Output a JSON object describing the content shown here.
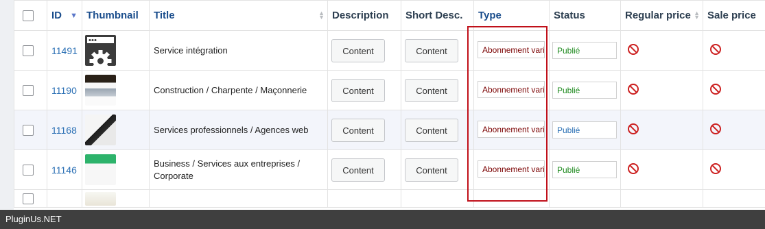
{
  "columns": {
    "id": "ID",
    "thumbnail": "Thumbnail",
    "title": "Title",
    "description": "Description",
    "short_desc": "Short Desc.",
    "type": "Type",
    "status": "Status",
    "regular_price": "Regular price",
    "sale_price": "Sale price"
  },
  "rows": [
    {
      "id": "11491",
      "title": "Service intégration",
      "description": "Content",
      "short_desc": "Content",
      "type": "Abonnement variable",
      "status": "Publié",
      "status_color": "#1e8a1e"
    },
    {
      "id": "11190",
      "title": "Construction / Charpente / Maçonnerie",
      "description": "Content",
      "short_desc": "Content",
      "type": "Abonnement variable",
      "status": "Publié",
      "status_color": "#1e8a1e"
    },
    {
      "id": "11168",
      "title": "Services professionnels / Agences web",
      "description": "Content",
      "short_desc": "Content",
      "type": "Abonnement variable",
      "status": "Publié",
      "status_color": "#2a6fb4"
    },
    {
      "id": "11146",
      "title": "Business / Services aux entreprises / Corporate",
      "description": "Content",
      "short_desc": "Content",
      "type": "Abonnement variable",
      "status": "Publié",
      "status_color": "#1e8a1e"
    }
  ],
  "footer": {
    "text": "PluginUs.NET"
  },
  "colors": {
    "highlight": "#c0101a",
    "id_link": "#2a6fb4",
    "footer_bg": "#3f3f3f"
  }
}
